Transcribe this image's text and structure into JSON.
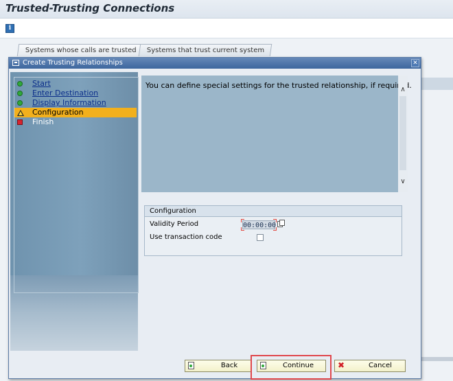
{
  "screen": {
    "title": "Trusted-Trusting Connections",
    "tabs": [
      {
        "label": "Systems whose calls are trusted"
      },
      {
        "label": "Systems that trust current system"
      }
    ]
  },
  "dialog": {
    "title": "Create Trusting Relationships",
    "close_icon": "close-icon",
    "steps": [
      {
        "label": "Start",
        "status": "done"
      },
      {
        "label": "Enter Destination",
        "status": "done"
      },
      {
        "label": "Display Information",
        "status": "done"
      },
      {
        "label": "Configuration",
        "status": "current"
      },
      {
        "label": "Finish",
        "status": "pending"
      }
    ],
    "description": "You can define special settings for the trusted relationship, if required.",
    "configuration": {
      "title": "Configuration",
      "validity_label": "Validity Period",
      "validity_value": "00:00:00",
      "use_tx_label": "Use transaction code",
      "use_tx_checked": false
    },
    "buttons": {
      "back": "Back",
      "continue": "Continue",
      "cancel": "Cancel"
    }
  },
  "colors": {
    "accent": "#f2b01d",
    "highlight": "#e0474c",
    "title_bar": "#3d679e"
  }
}
